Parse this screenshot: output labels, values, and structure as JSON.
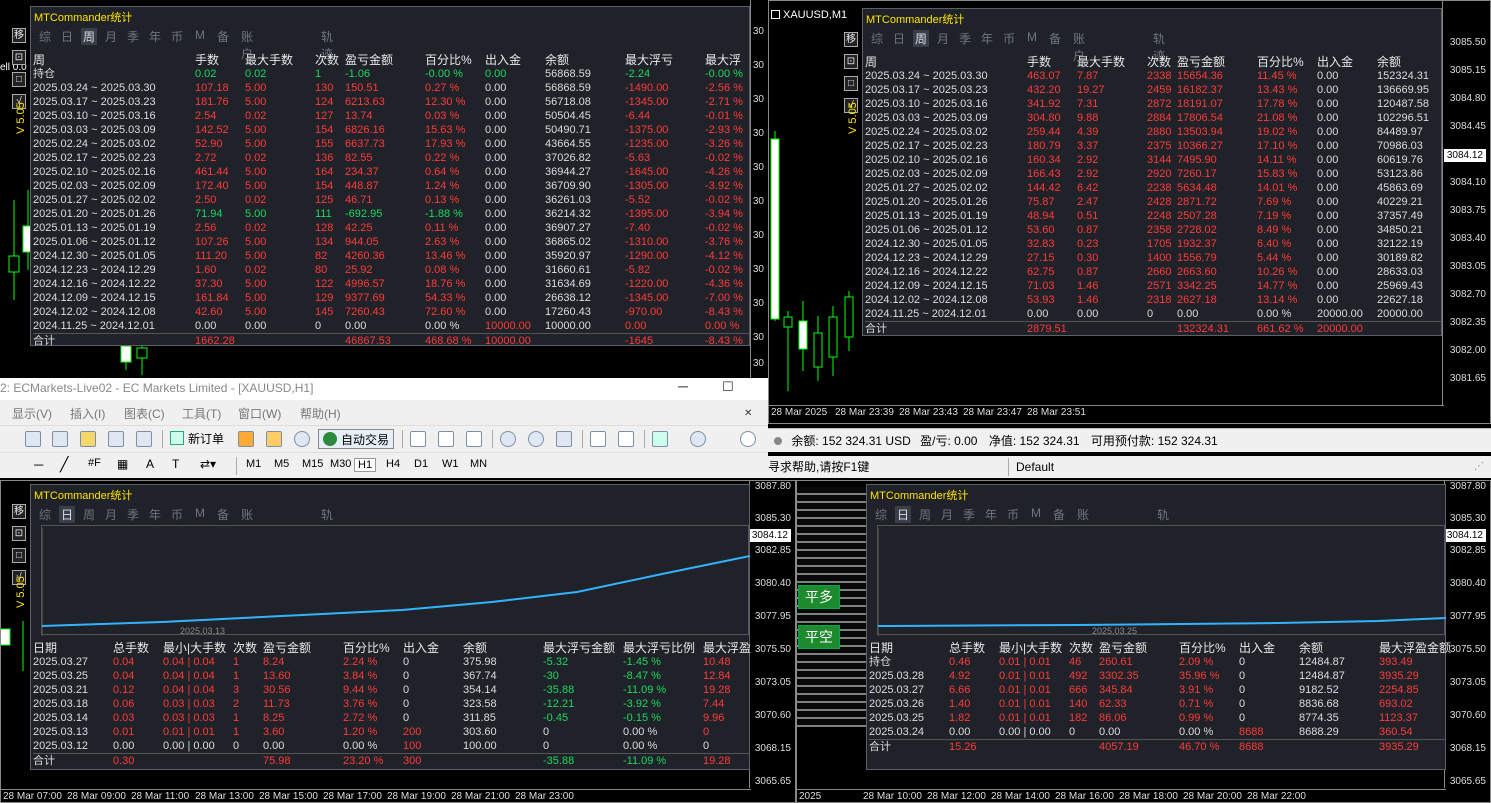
{
  "tl": {
    "title": "MTCommander统计",
    "side_buttons": [
      "移",
      "⊡",
      "□",
      "√"
    ],
    "version": "V 5.05",
    "tabs": [
      "综",
      "日",
      "周",
      "月",
      "季",
      "年",
      "币",
      "M",
      "备",
      "账户",
      "轨迹"
    ],
    "active_tab": "周",
    "headers": [
      "周",
      "手数",
      "最大手数",
      "次数",
      "盈亏金额",
      "百分比%",
      "出入金",
      "余额",
      "最大浮亏",
      "最大浮"
    ],
    "hold": [
      "持仓",
      "0.02",
      "0.02",
      "1",
      "-1.06",
      "-0.00 %",
      "0.00",
      "56868.59",
      "-2.24",
      "-0.00 %"
    ],
    "rows": [
      [
        "2025.03.24 ~ 2025.03.30",
        "107.18",
        "5.00",
        "130",
        "150.51",
        "0.27 %",
        "0.00",
        "56868.59",
        "-1490.00",
        "-2.56 %"
      ],
      [
        "2025.03.17 ~ 2025.03.23",
        "181.76",
        "5.00",
        "124",
        "6213.63",
        "12.30 %",
        "0.00",
        "56718.08",
        "-1345.00",
        "-2.71 %"
      ],
      [
        "2025.03.10 ~ 2025.03.16",
        "2.54",
        "0.02",
        "127",
        "13.74",
        "0.03 %",
        "0.00",
        "50504.45",
        "-6.44",
        "-0.01 %"
      ],
      [
        "2025.03.03 ~ 2025.03.09",
        "142.52",
        "5.00",
        "154",
        "6826.16",
        "15.63 %",
        "0.00",
        "50490.71",
        "-1375.00",
        "-2.93 %"
      ],
      [
        "2025.02.24 ~ 2025.03.02",
        "52.90",
        "5.00",
        "155",
        "6637.73",
        "17.93 %",
        "0.00",
        "43664.55",
        "-1235.00",
        "-3.26 %"
      ],
      [
        "2025.02.17 ~ 2025.02.23",
        "2.72",
        "0.02",
        "136",
        "82.55",
        "0.22 %",
        "0.00",
        "37026.82",
        "-5.63",
        "-0.02 %"
      ],
      [
        "2025.02.10 ~ 2025.02.16",
        "461.44",
        "5.00",
        "164",
        "234.37",
        "0.64 %",
        "0.00",
        "36944.27",
        "-1645.00",
        "-4.26 %"
      ],
      [
        "2025.02.03 ~ 2025.02.09",
        "172.40",
        "5.00",
        "154",
        "448.87",
        "1.24 %",
        "0.00",
        "36709.90",
        "-1305.00",
        "-3.92 %"
      ],
      [
        "2025.01.27 ~ 2025.02.02",
        "2.50",
        "0.02",
        "125",
        "46.71",
        "0.13 %",
        "0.00",
        "36261.03",
        "-5.52",
        "-0.02 %"
      ],
      [
        "2025.01.20 ~ 2025.01.26",
        "71.94",
        "5.00",
        "111",
        "-692.95",
        "-1.88 %",
        "0.00",
        "36214.32",
        "-1395.00",
        "-3.94 %"
      ],
      [
        "2025.01.13 ~ 2025.01.19",
        "2.56",
        "0.02",
        "128",
        "42.25",
        "0.11 %",
        "0.00",
        "36907.27",
        "-7.40",
        "-0.02 %"
      ],
      [
        "2025.01.06 ~ 2025.01.12",
        "107.26",
        "5.00",
        "134",
        "944.05",
        "2.63 %",
        "0.00",
        "36865.02",
        "-1310.00",
        "-3.76 %"
      ],
      [
        "2024.12.30 ~ 2025.01.05",
        "111.20",
        "5.00",
        "82",
        "4260.36",
        "13.46 %",
        "0.00",
        "35920.97",
        "-1290.00",
        "-4.12 %"
      ],
      [
        "2024.12.23 ~ 2024.12.29",
        "1.60",
        "0.02",
        "80",
        "25.92",
        "0.08 %",
        "0.00",
        "31660.61",
        "-5.82",
        "-0.02 %"
      ],
      [
        "2024.12.16 ~ 2024.12.22",
        "37.30",
        "5.00",
        "122",
        "4996.57",
        "18.76 %",
        "0.00",
        "31634.69",
        "-1220.00",
        "-4.36 %"
      ],
      [
        "2024.12.09 ~ 2024.12.15",
        "161.84",
        "5.00",
        "129",
        "9377.69",
        "54.33 %",
        "0.00",
        "26638.12",
        "-1345.00",
        "-7.00 %"
      ],
      [
        "2024.12.02 ~ 2024.12.08",
        "42.60",
        "5.00",
        "145",
        "7260.43",
        "72.60 %",
        "0.00",
        "17260.43",
        "-970.00",
        "-8.43 %"
      ],
      [
        "2024.11.25 ~ 2024.12.01",
        "0.00",
        "0.00",
        "0",
        "0.00",
        "0.00 %",
        "10000.00",
        "10000.00",
        "0.00",
        "0.00 %"
      ]
    ],
    "total": [
      "合计",
      "1662.28",
      "",
      "",
      "46867.53",
      "468.68 %",
      "10000.00",
      "",
      "-1645",
      "-8.43 %"
    ]
  },
  "tl_chart": {
    "label": "ell 0.0"
  },
  "tr": {
    "symbol": "XAUUSD,M1",
    "title": "MTCommander统计",
    "side_buttons": [
      "移",
      "⊡",
      "□",
      "√"
    ],
    "version": "V 5.05",
    "tabs": [
      "综",
      "日",
      "周",
      "月",
      "季",
      "年",
      "币",
      "M",
      "备",
      "账户",
      "轨迹"
    ],
    "active_tab": "周",
    "headers": [
      "周",
      "手数",
      "最大手数",
      "次数",
      "盈亏金额",
      "百分比%",
      "出入金",
      "余额"
    ],
    "rows": [
      [
        "2025.03.24 ~ 2025.03.30",
        "463.07",
        "7.87",
        "2338",
        "15654.36",
        "11.45 %",
        "0.00",
        "152324.31"
      ],
      [
        "2025.03.17 ~ 2025.03.23",
        "432.20",
        "19.27",
        "2459",
        "16182.37",
        "13.43 %",
        "0.00",
        "136669.95"
      ],
      [
        "2025.03.10 ~ 2025.03.16",
        "341.92",
        "7.31",
        "2872",
        "18191.07",
        "17.78 %",
        "0.00",
        "120487.58"
      ],
      [
        "2025.03.03 ~ 2025.03.09",
        "304.80",
        "9.88",
        "2884",
        "17806.54",
        "21.08 %",
        "0.00",
        "102296.51"
      ],
      [
        "2025.02.24 ~ 2025.03.02",
        "259.44",
        "4.39",
        "2880",
        "13503.94",
        "19.02 %",
        "0.00",
        "84489.97"
      ],
      [
        "2025.02.17 ~ 2025.02.23",
        "180.79",
        "3.37",
        "2375",
        "10366.27",
        "17.10 %",
        "0.00",
        "70986.03"
      ],
      [
        "2025.02.10 ~ 2025.02.16",
        "160.34",
        "2.92",
        "3144",
        "7495.90",
        "14.11 %",
        "0.00",
        "60619.76"
      ],
      [
        "2025.02.03 ~ 2025.02.09",
        "166.43",
        "2.92",
        "2920",
        "7260.17",
        "15.83 %",
        "0.00",
        "53123.86"
      ],
      [
        "2025.01.27 ~ 2025.02.02",
        "144.42",
        "6.42",
        "2238",
        "5634.48",
        "14.01 %",
        "0.00",
        "45863.69"
      ],
      [
        "2025.01.20 ~ 2025.01.26",
        "75.87",
        "2.47",
        "2428",
        "2871.72",
        "7.69 %",
        "0.00",
        "40229.21"
      ],
      [
        "2025.01.13 ~ 2025.01.19",
        "48.94",
        "0.51",
        "2248",
        "2507.28",
        "7.19 %",
        "0.00",
        "37357.49"
      ],
      [
        "2025.01.06 ~ 2025.01.12",
        "53.60",
        "0.87",
        "2358",
        "2728.02",
        "8.49 %",
        "0.00",
        "34850.21"
      ],
      [
        "2024.12.30 ~ 2025.01.05",
        "32.83",
        "0.23",
        "1705",
        "1932.37",
        "6.40 %",
        "0.00",
        "32122.19"
      ],
      [
        "2024.12.23 ~ 2024.12.29",
        "27.15",
        "0.30",
        "1400",
        "1556.79",
        "5.44 %",
        "0.00",
        "30189.82"
      ],
      [
        "2024.12.16 ~ 2024.12.22",
        "62.75",
        "0.87",
        "2660",
        "2663.60",
        "10.26 %",
        "0.00",
        "28633.03"
      ],
      [
        "2024.12.09 ~ 2024.12.15",
        "71.03",
        "1.46",
        "2571",
        "3342.25",
        "14.77 %",
        "0.00",
        "25969.43"
      ],
      [
        "2024.12.02 ~ 2024.12.08",
        "53.93",
        "1.46",
        "2318",
        "2627.18",
        "13.14 %",
        "0.00",
        "22627.18"
      ],
      [
        "2024.11.25 ~ 2024.12.01",
        "0.00",
        "0.00",
        "0",
        "0.00",
        "0.00 %",
        "20000.00",
        "20000.00"
      ]
    ],
    "total": [
      "合计",
      "2879.51",
      "",
      "",
      "132324.31",
      "661.62 %",
      "20000.00",
      ""
    ],
    "prices": [
      "3085.50",
      "3085.15",
      "3084.80",
      "3084.45",
      "3084.12",
      "3084.10",
      "3083.75",
      "3083.40",
      "3083.05",
      "3082.70",
      "3082.35",
      "3082.00",
      "3081.65"
    ],
    "times": [
      "28 Mar 2025",
      "28 Mar 23:39",
      "28 Mar 23:43",
      "28 Mar 23:47",
      "28 Mar 23:51"
    ]
  },
  "mid": {
    "window_title": "2: ECMarkets-Live02 - EC Markets Limited - [XAUUSD,H1]",
    "menu": [
      "显示(V)",
      "插入(I)",
      "图表(C)",
      "工具(T)",
      "窗口(W)",
      "帮助(H)"
    ],
    "new_order": "新订单",
    "auto_trade": "自动交易",
    "periods": [
      "M1",
      "M5",
      "M15",
      "M30",
      "H1",
      "H4",
      "D1",
      "W1",
      "MN"
    ],
    "active_period": "H1",
    "status_text": "寻求帮助,请按F1键",
    "profile": "Default",
    "balance_label": "余额:",
    "balance": "152 324.31 USD",
    "pl_label": "盈/亏:",
    "pl": "0.00",
    "equity_label": "净值:",
    "equity": "152 324.31",
    "free_margin_label": "可用预付款:",
    "free_margin": "152 324.31"
  },
  "bl": {
    "title": "MTCommander统计",
    "side_buttons": [
      "移",
      "⊡",
      "□",
      "√"
    ],
    "version": "V 5.05",
    "tabs": [
      "综",
      "日",
      "周",
      "月",
      "季",
      "年",
      "币",
      "M",
      "备",
      "账户",
      "轨迹"
    ],
    "active_tab": "日",
    "equity_date": "2025.03.13",
    "headers": [
      "日期",
      "总手数",
      "最小|大手数",
      "次数",
      "盈亏金额",
      "百分比%",
      "出入金",
      "余额",
      "最大浮亏金额",
      "最大浮亏比例",
      "最大浮盈"
    ],
    "rows": [
      [
        "2025.03.27",
        "0.04",
        "0.04 | 0.04",
        "1",
        "8.24",
        "2.24 %",
        "0",
        "375.98",
        "-5.32",
        "-1.45 %",
        "10.48"
      ],
      [
        "2025.03.25",
        "0.04",
        "0.04 | 0.04",
        "1",
        "13.60",
        "3.84 %",
        "0",
        "367.74",
        "-30",
        "-8.47 %",
        "12.84"
      ],
      [
        "2025.03.21",
        "0.12",
        "0.04 | 0.04",
        "3",
        "30.56",
        "9.44 %",
        "0",
        "354.14",
        "-35.88",
        "-11.09 %",
        "19.28"
      ],
      [
        "2025.03.18",
        "0.06",
        "0.03 | 0.03",
        "2",
        "11.73",
        "3.76 %",
        "0",
        "323.58",
        "-12.21",
        "-3.92 %",
        "7.44"
      ],
      [
        "2025.03.14",
        "0.03",
        "0.03 | 0.03",
        "1",
        "8.25",
        "2.72 %",
        "0",
        "311.85",
        "-0.45",
        "-0.15 %",
        "9.96"
      ],
      [
        "2025.03.13",
        "0.01",
        "0.01 | 0.01",
        "1",
        "3.60",
        "1.20 %",
        "200",
        "303.60",
        "0",
        "0.00 %",
        "0"
      ],
      [
        "2025.03.12",
        "0.00",
        "0.00 | 0.00",
        "0",
        "0.00",
        "0.00 %",
        "100",
        "100.00",
        "0",
        "0.00 %",
        "0"
      ]
    ],
    "total": [
      "合计",
      "0.30",
      "",
      "",
      "75.98",
      "23.20 %",
      "300",
      "",
      "-35.88",
      "-11.09 %",
      "19.28"
    ],
    "prices": [
      "3087.80",
      "3085.30",
      "3084.12",
      "3082.85",
      "3080.40",
      "3077.95",
      "3075.50",
      "3073.05",
      "3070.60",
      "3068.15",
      "3065.65"
    ],
    "times": [
      "28 Mar 07:00",
      "28 Mar 09:00",
      "28 Mar 11:00",
      "28 Mar 13:00",
      "28 Mar 15:00",
      "28 Mar 17:00",
      "28 Mar 19:00",
      "28 Mar 21:00",
      "28 Mar 23:00"
    ]
  },
  "br": {
    "title": "MTCommander统计",
    "side_buttons": [
      "移",
      "⊡",
      "□",
      "√"
    ],
    "tabs": [
      "综",
      "日",
      "周",
      "月",
      "季",
      "年",
      "币",
      "M",
      "备",
      "账户",
      "轨迹"
    ],
    "active_tab": "日",
    "equity_date": "2025.03.25",
    "close_long": "平多",
    "close_short": "平空",
    "headers": [
      "日期",
      "总手数",
      "最小|大手数",
      "次数",
      "盈亏金额",
      "百分比%",
      "出入金",
      "余额",
      "最大浮盈金额"
    ],
    "hold": [
      "持仓",
      "0.46",
      "0.01 | 0.01",
      "46",
      "260.61",
      "2.09 %",
      "0",
      "12484.87",
      "393.49"
    ],
    "rows": [
      [
        "2025.03.28",
        "4.92",
        "0.01 | 0.01",
        "492",
        "3302.35",
        "35.96 %",
        "0",
        "12484.87",
        "3935.29"
      ],
      [
        "2025.03.27",
        "6.66",
        "0.01 | 0.01",
        "666",
        "345.84",
        "3.91 %",
        "0",
        "9182.52",
        "2254.85"
      ],
      [
        "2025.03.26",
        "1.40",
        "0.01 | 0.01",
        "140",
        "62.33",
        "0.71 %",
        "0",
        "8836.68",
        "693.02"
      ],
      [
        "2025.03.25",
        "1.82",
        "0.01 | 0.01",
        "182",
        "86.06",
        "0.99 %",
        "0",
        "8774.35",
        "1123.37"
      ],
      [
        "2025.03.24",
        "0.00",
        "0.00 | 0.00",
        "0",
        "0.00",
        "0.00 %",
        "8688",
        "8688.29",
        "360.54"
      ]
    ],
    "total": [
      "合计",
      "15.26",
      "",
      "",
      "4057.19",
      "46.70 %",
      "8688",
      "",
      "3935.29"
    ],
    "prices": [
      "3087.80",
      "3085.30",
      "3084.12",
      "3082.85",
      "3080.40",
      "3077.95",
      "3075.50",
      "3073.05",
      "3070.60",
      "3068.15",
      "3065.65"
    ],
    "times": [
      "2025",
      "28 Mar 10:00",
      "28 Mar 12:00",
      "28 Mar 14:00",
      "28 Mar 16:00",
      "28 Mar 18:00",
      "28 Mar 20:00",
      "28 Mar 22:00"
    ]
  }
}
